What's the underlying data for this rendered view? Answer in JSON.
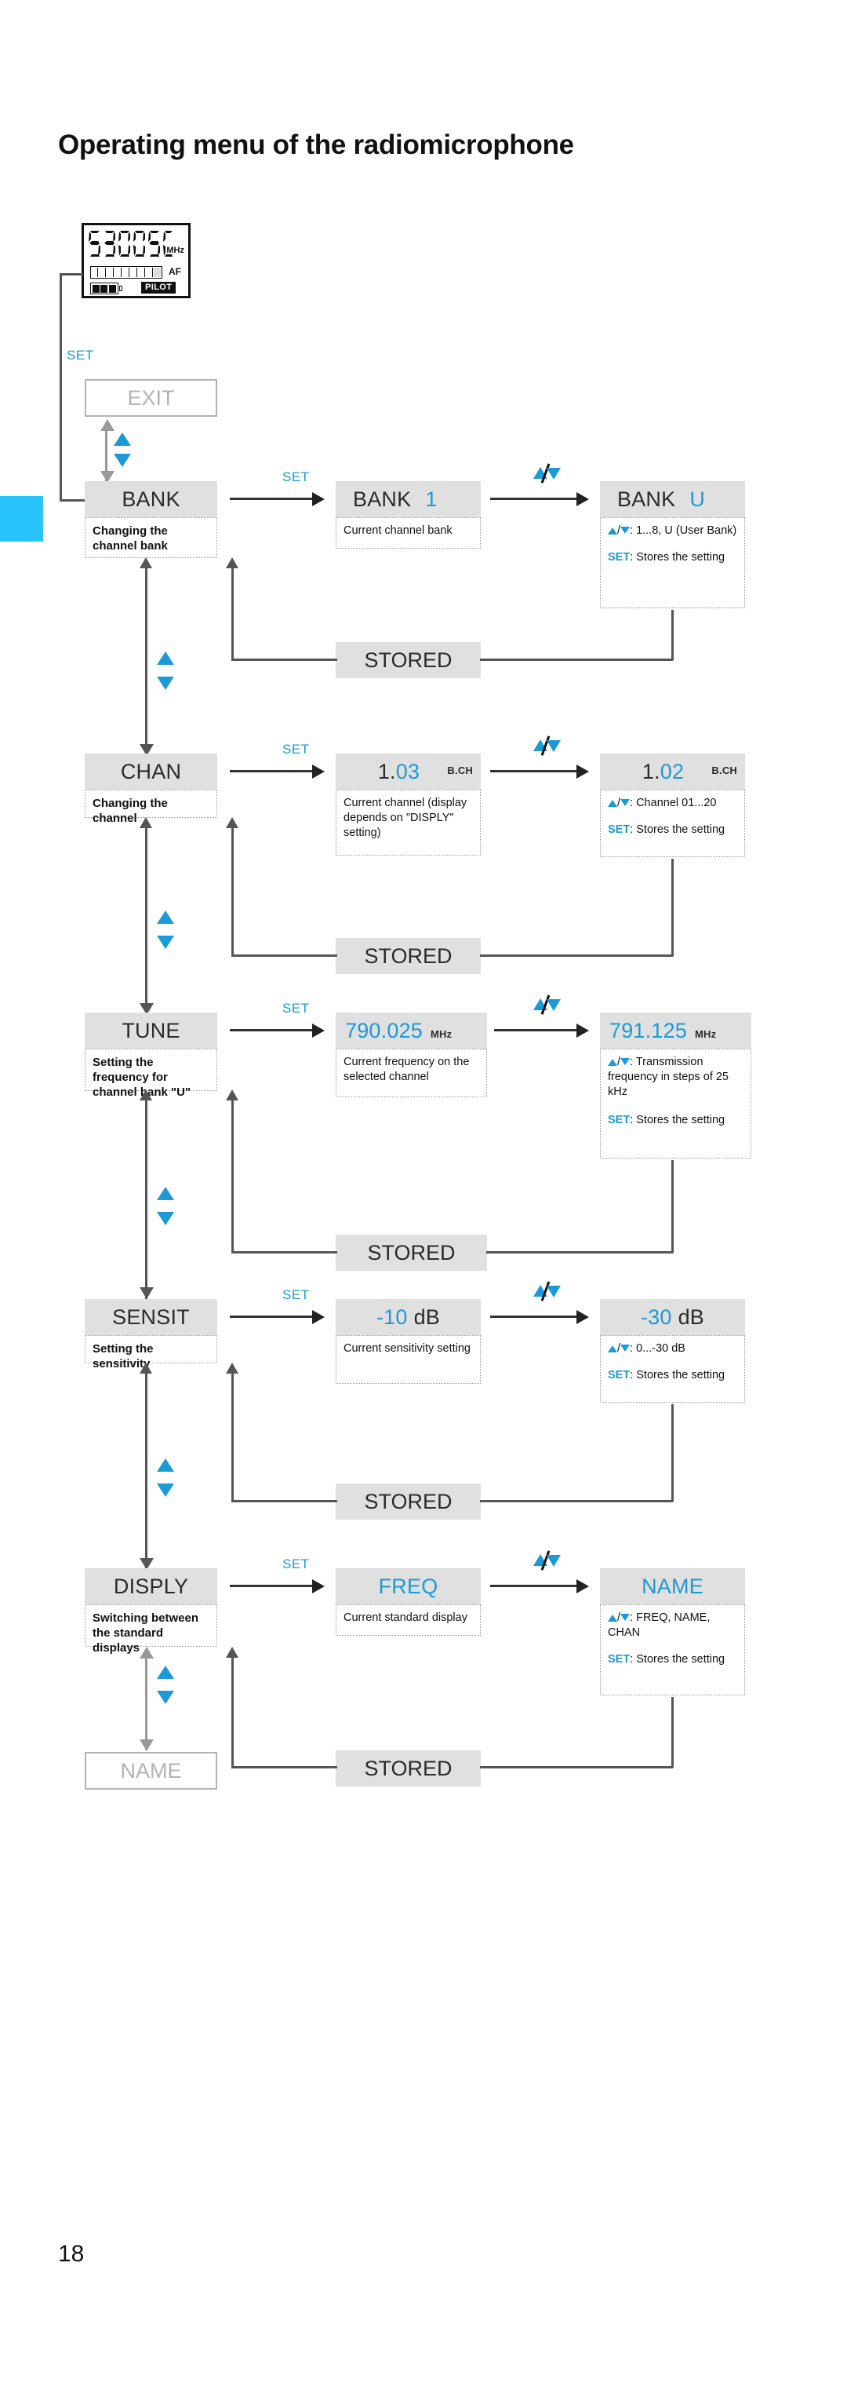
{
  "page": {
    "title": "Operating menu of the radiomicrophone",
    "number": "18",
    "tab_color": "#29c3fc",
    "accent_color": "#1b9ad6",
    "header_bg": "#e0e0e0"
  },
  "lcd": {
    "frequency": "530050",
    "unit": "MHz",
    "af_label": "AF",
    "pilot_label": "PILOT",
    "battery_cells": 3,
    "af_segments_filled": 8,
    "af_segments_total": 9
  },
  "labels": {
    "set": "SET",
    "updown": "▲/▼",
    "stored": "STORED"
  },
  "ghost_boxes": {
    "exit": "EXIT",
    "name": "NAME"
  },
  "rows": [
    {
      "id": "bank",
      "menu_label": "BANK",
      "menu_desc": "Changing the channel bank",
      "transition_label": "SET",
      "value_label": "BANK",
      "value_value": "1",
      "value_desc": "Current channel bank",
      "edit_transition_label": "▲/▼",
      "edit_label": "BANK",
      "edit_value": "U",
      "edit_range": ": 1...8, U (User Bank)",
      "edit_store": "Stores the setting",
      "stored_label": "STORED"
    },
    {
      "id": "chan",
      "menu_label": "CHAN",
      "menu_desc": "Changing the channel",
      "transition_label": "SET",
      "value_label": "1.",
      "value_value": "03",
      "value_suffix": "B.CH",
      "value_desc": "Current channel (display depends on \"DISPLY\" setting)",
      "edit_transition_label": "▲/▼",
      "edit_label": "1.",
      "edit_value": "02",
      "edit_suffix": "B.CH",
      "edit_range": ": Channel  01...20",
      "edit_store": "Stores the setting",
      "stored_label": "STORED"
    },
    {
      "id": "tune",
      "menu_label": "TUNE",
      "menu_desc": "Setting the frequency for channel bank \"U\"",
      "transition_label": "SET",
      "value_value": "790.025",
      "value_suffix": "MHz",
      "value_desc": "Current frequency on the selected channel",
      "edit_transition_label": "▲/▼",
      "edit_value": "791.125",
      "edit_suffix": "MHz",
      "edit_range": ": Transmission frequency in steps of 25 kHz",
      "edit_store": "Stores the setting",
      "stored_label": "STORED"
    },
    {
      "id": "sensit",
      "menu_label": "SENSIT",
      "menu_desc": "Setting the sensitivity",
      "transition_label": "SET",
      "value_prefix": "-",
      "value_value": "10",
      "value_suffix": "dB",
      "value_desc": "Current sensitivity setting",
      "edit_transition_label": "▲/▼",
      "edit_prefix": "-",
      "edit_value": "30",
      "edit_suffix": "dB",
      "edit_range": ": 0...-30 dB",
      "edit_store": "Stores the setting",
      "stored_label": "STORED"
    },
    {
      "id": "disply",
      "menu_label": "DISPLY",
      "menu_desc": "Switching between the standard displays",
      "transition_label": "SET",
      "value_value": "FREQ",
      "value_desc": "Current standard display",
      "edit_transition_label": "▲/▼",
      "edit_value": "NAME",
      "edit_range": ": FREQ, NAME, CHAN",
      "edit_store": "Stores the setting",
      "stored_label": "STORED"
    }
  ]
}
